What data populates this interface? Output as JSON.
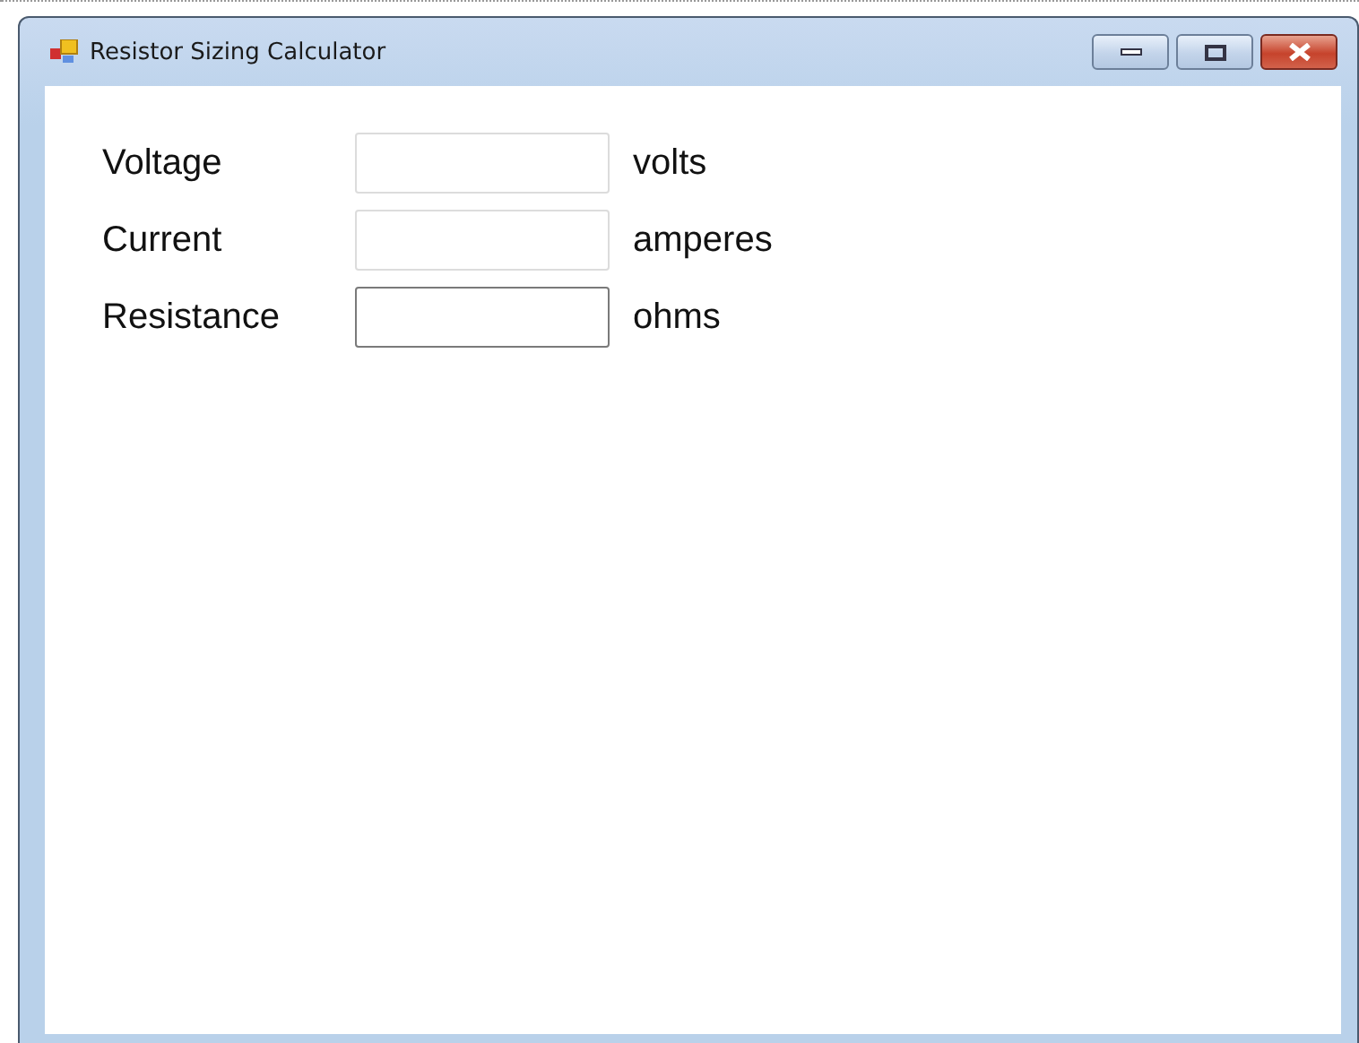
{
  "window": {
    "title": "Resistor Sizing Calculator"
  },
  "fields": [
    {
      "label": "Voltage",
      "unit": "volts",
      "focused": false
    },
    {
      "label": "Current",
      "unit": "amperes",
      "focused": false
    },
    {
      "label": "Resistance",
      "unit": "ohms",
      "focused": true
    }
  ]
}
